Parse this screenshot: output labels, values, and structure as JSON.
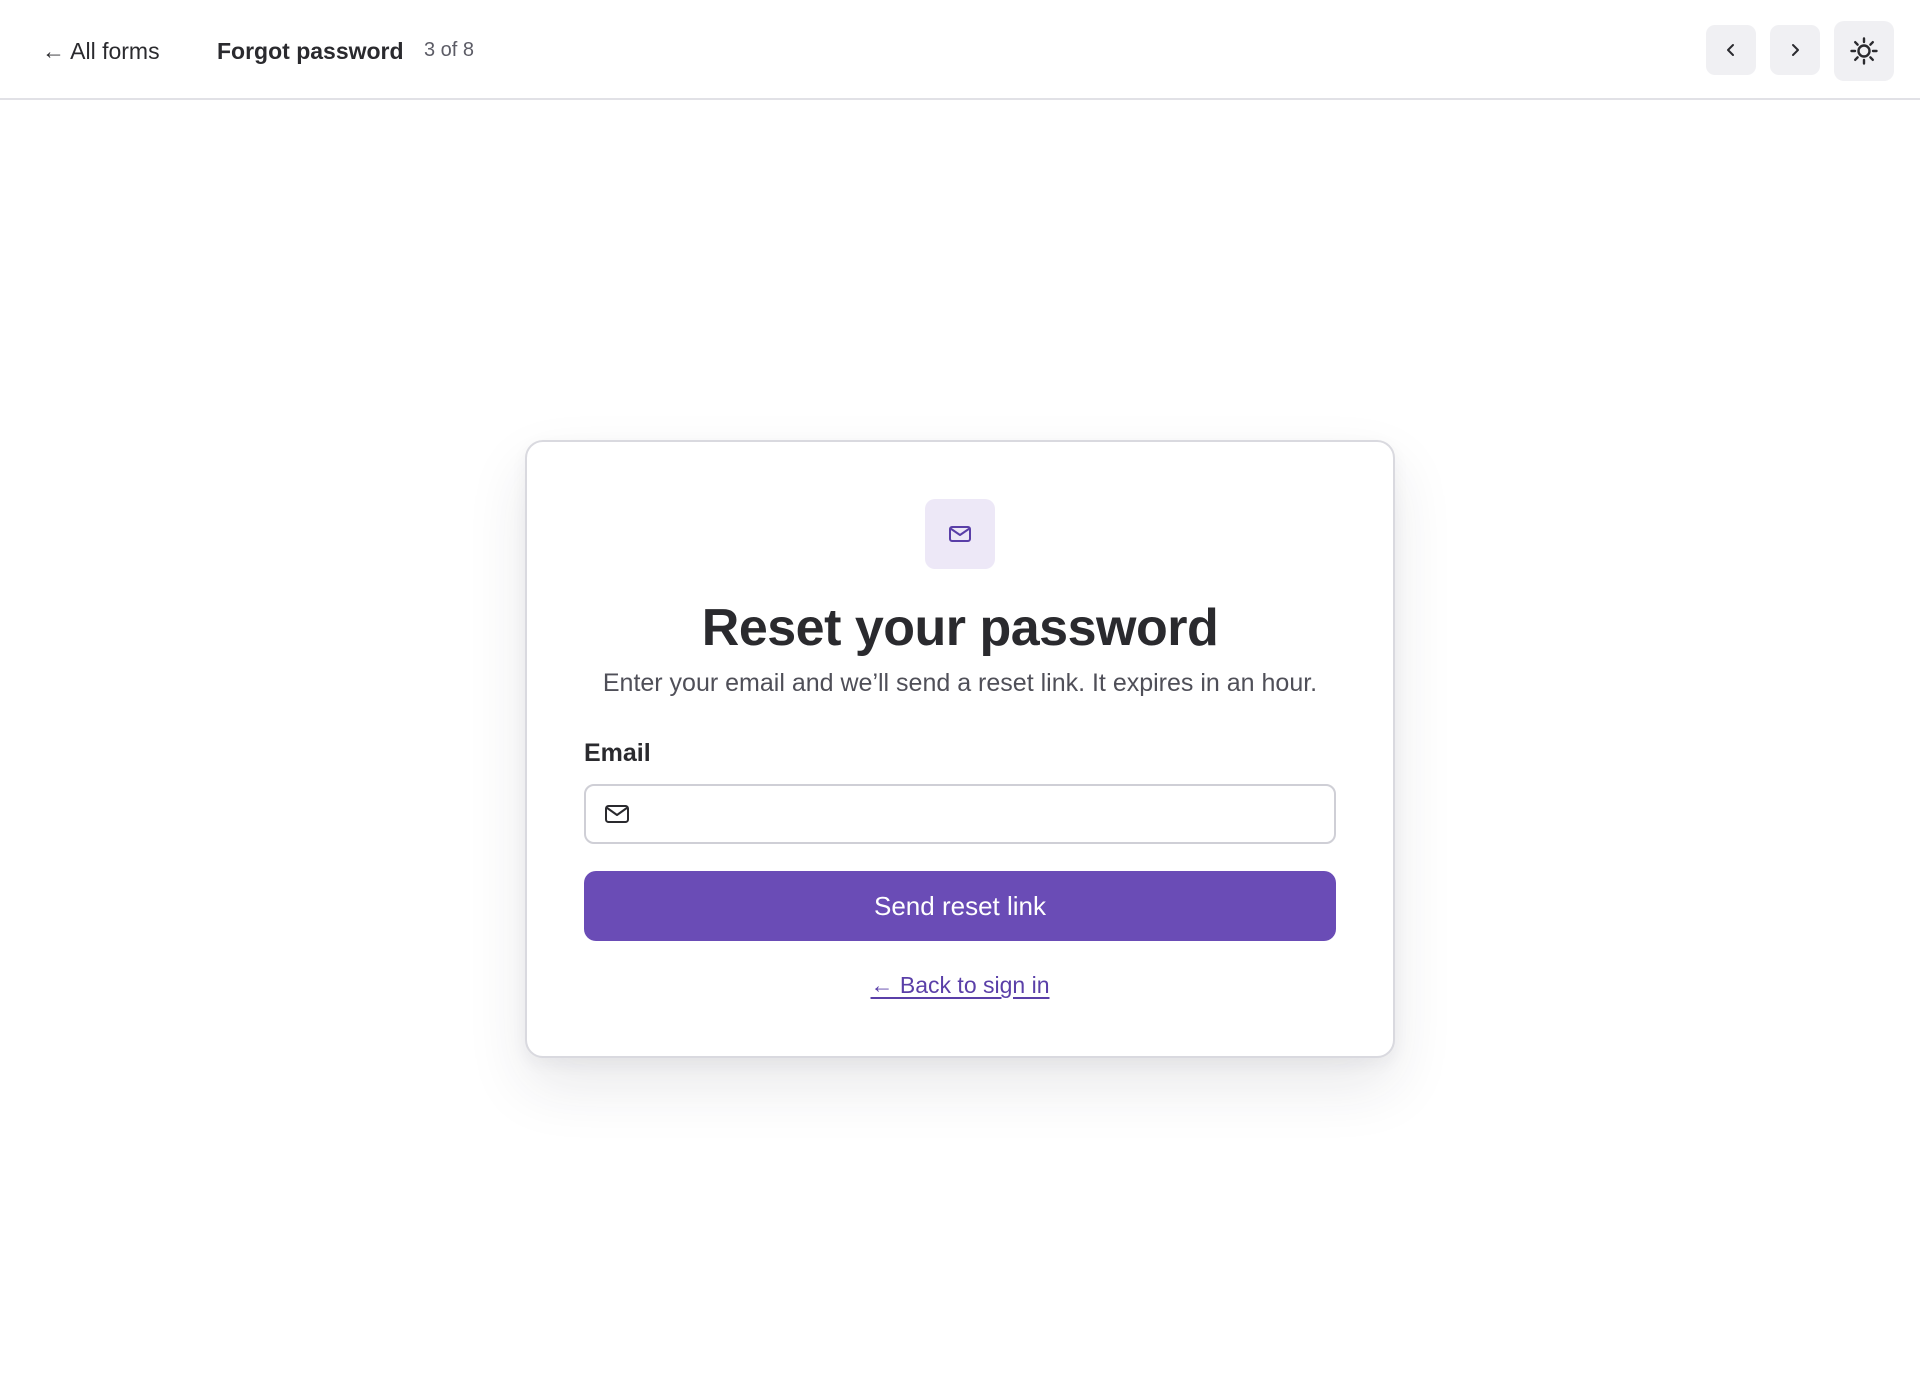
{
  "header": {
    "back_label": "← All forms",
    "form_title": "Forgot password",
    "form_counter": "3 of 8",
    "prev_icon": "chevron-left-icon",
    "next_icon": "chevron-right-icon",
    "theme_icon": "sun-icon"
  },
  "card": {
    "badge_icon": "mail-icon",
    "title": "Reset your password",
    "subtitle": "Enter your email and we’ll send a reset link. It expires in an hour.",
    "email_label": "Email",
    "email_value": "",
    "email_icon": "mail-icon",
    "submit_label": "Send reset link",
    "back_to_signin_label": "← Back to sign in"
  },
  "colors": {
    "accent": "#6a4cb6",
    "accent_link": "#5a3fa8",
    "badge_bg": "#ede8f7",
    "text": "#2a2a2e"
  }
}
